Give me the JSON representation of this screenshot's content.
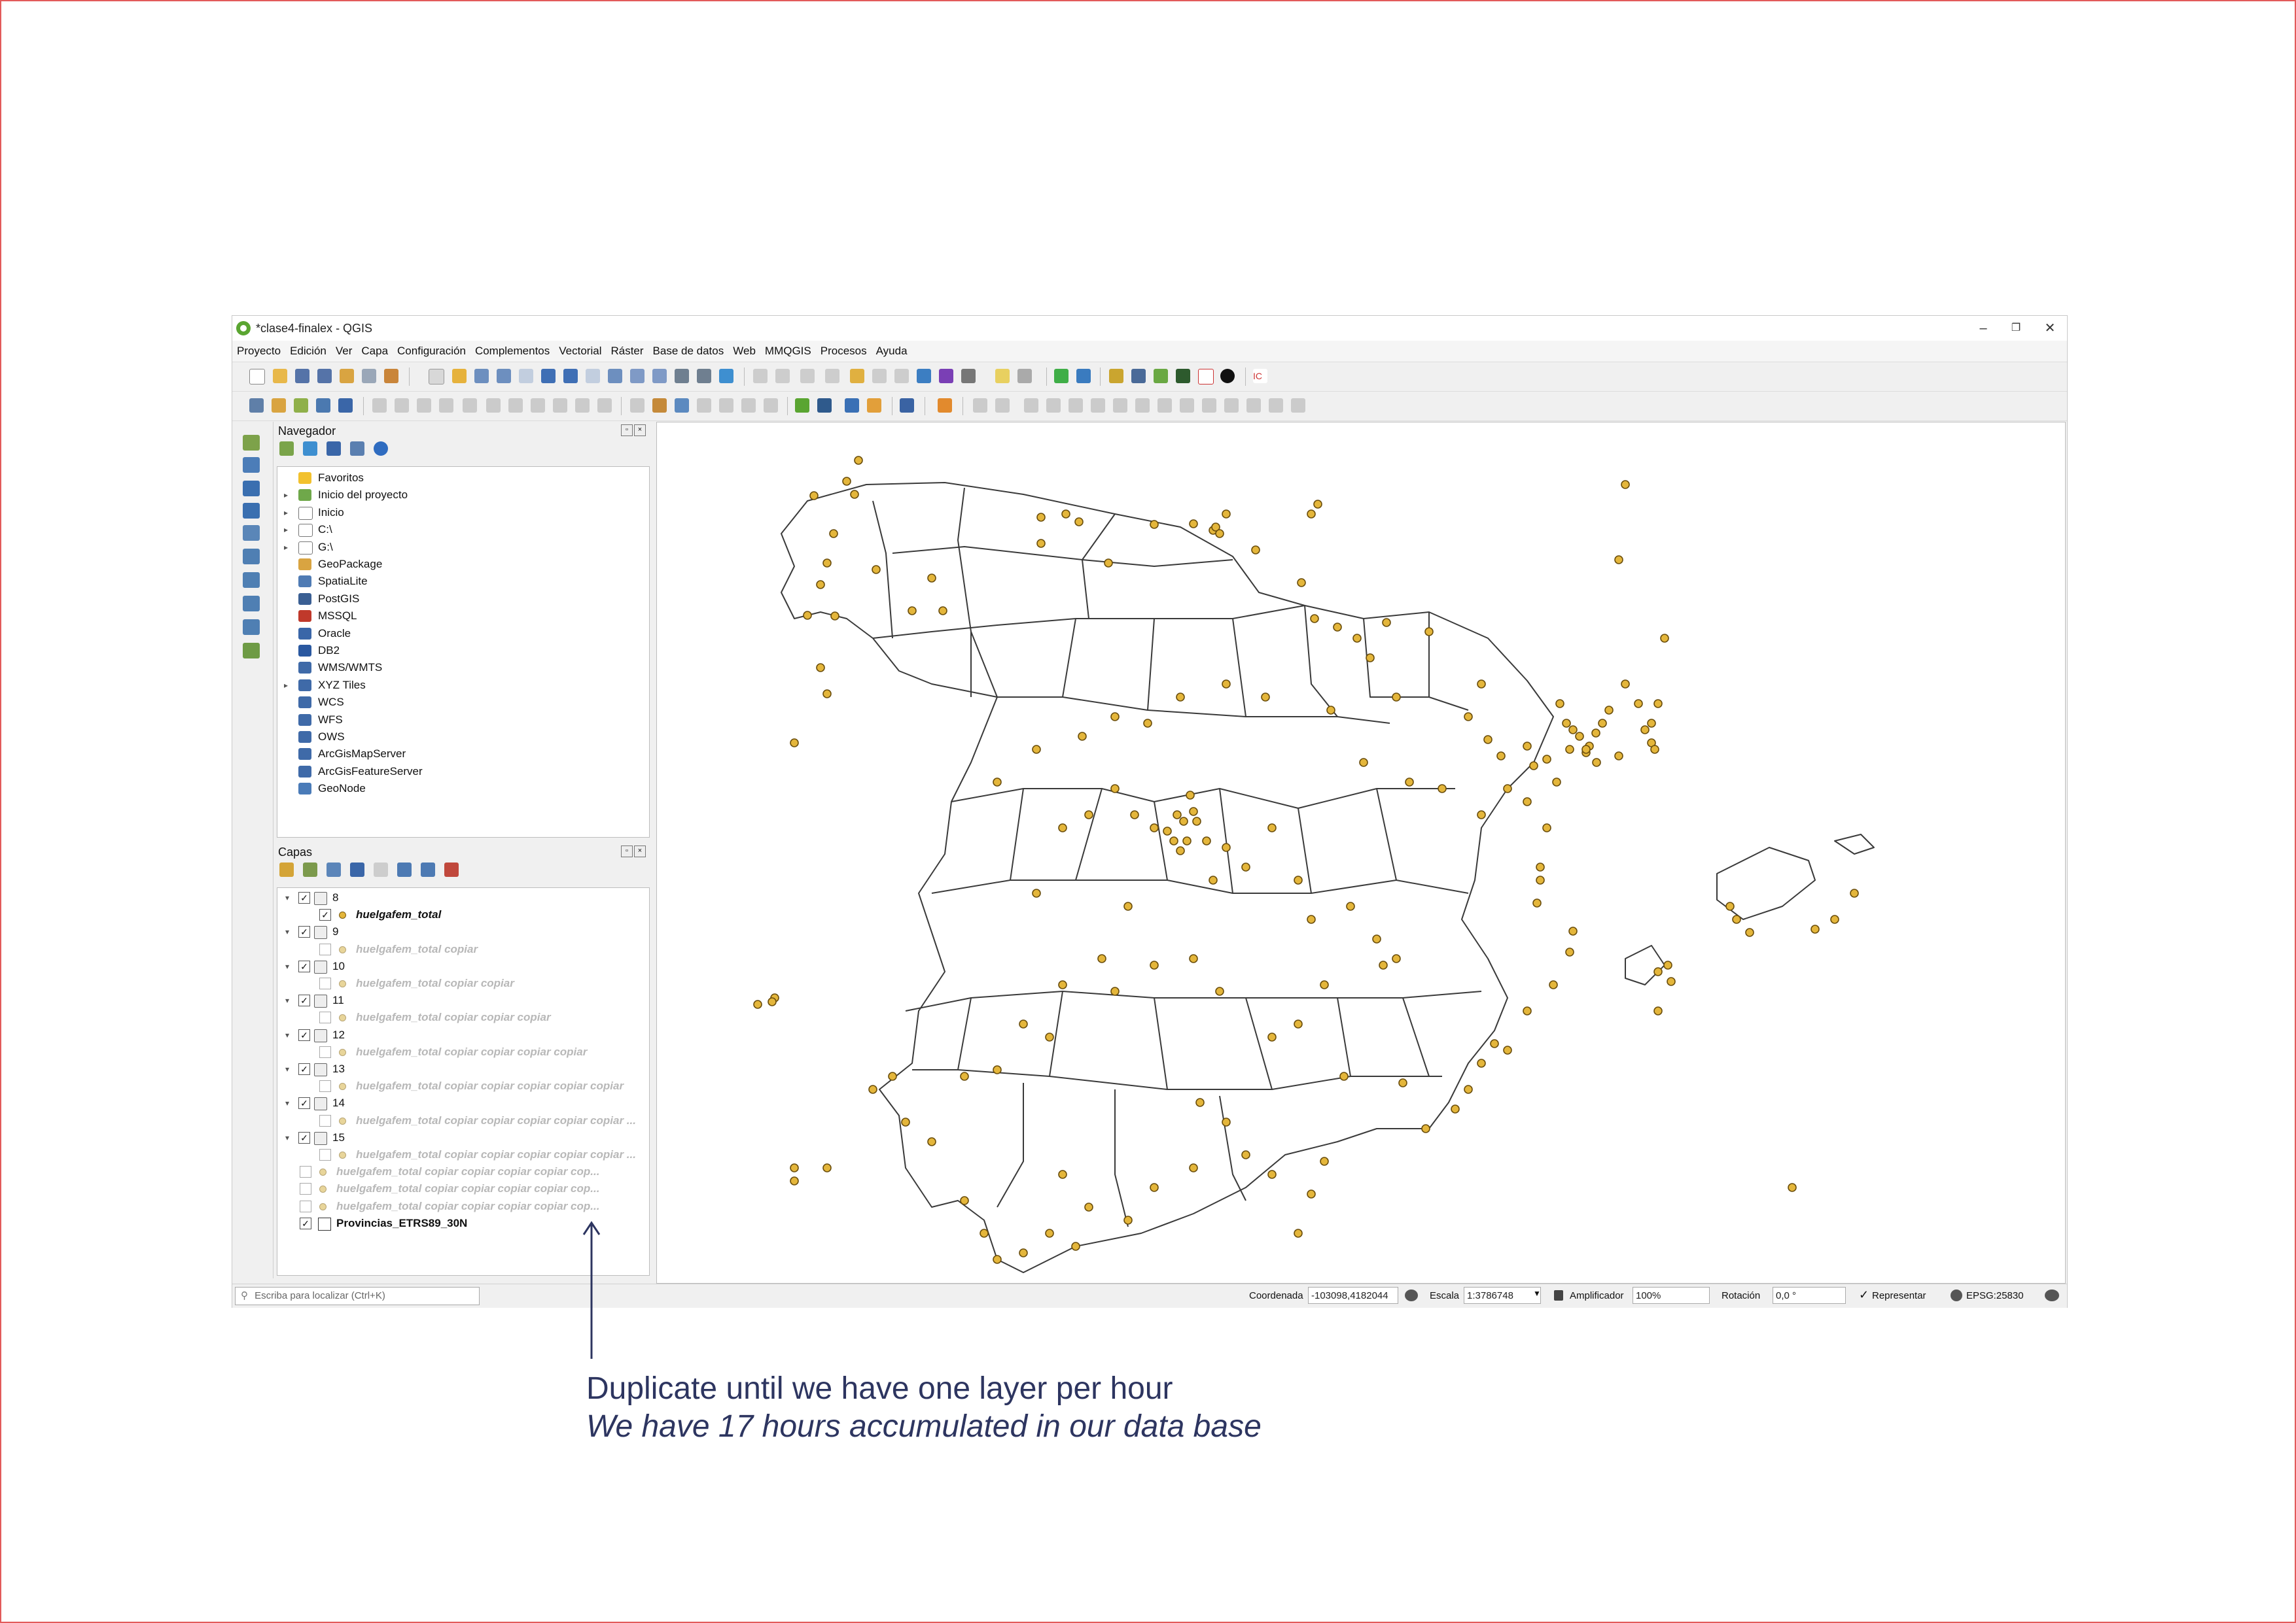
{
  "window": {
    "title": "*clase4-finalex - QGIS",
    "controls": [
      "–",
      "❐",
      "✕"
    ]
  },
  "menu": [
    "Proyecto",
    "Edición",
    "Ver",
    "Capa",
    "Configuración",
    "Complementos",
    "Vectorial",
    "Ráster",
    "Base de datos",
    "Web",
    "MMQGIS",
    "Procesos",
    "Ayuda"
  ],
  "navigator": {
    "title": "Navegador",
    "items": [
      {
        "label": "Favoritos",
        "icon": "star-icon",
        "expandable": false
      },
      {
        "label": "Inicio del proyecto",
        "icon": "project-home-icon",
        "expandable": true
      },
      {
        "label": "Inicio",
        "icon": "home-folder-icon",
        "expandable": true
      },
      {
        "label": "C:\\",
        "icon": "folder-icon",
        "expandable": true
      },
      {
        "label": "G:\\",
        "icon": "folder-icon",
        "expandable": true
      },
      {
        "label": "GeoPackage",
        "icon": "geopackage-icon",
        "expandable": false
      },
      {
        "label": "SpatiaLite",
        "icon": "spatialite-icon",
        "expandable": false
      },
      {
        "label": "PostGIS",
        "icon": "postgis-icon",
        "expandable": false
      },
      {
        "label": "MSSQL",
        "icon": "mssql-icon",
        "expandable": false
      },
      {
        "label": "Oracle",
        "icon": "oracle-icon",
        "expandable": false
      },
      {
        "label": "DB2",
        "icon": "db2-icon",
        "expandable": false
      },
      {
        "label": "WMS/WMTS",
        "icon": "globe-icon",
        "expandable": false
      },
      {
        "label": "XYZ Tiles",
        "icon": "globe-icon",
        "expandable": true
      },
      {
        "label": "WCS",
        "icon": "globe-icon",
        "expandable": false
      },
      {
        "label": "WFS",
        "icon": "globe-icon",
        "expandable": false
      },
      {
        "label": "OWS",
        "icon": "globe-icon",
        "expandable": false
      },
      {
        "label": "ArcGisMapServer",
        "icon": "arcgis-icon",
        "expandable": false
      },
      {
        "label": "ArcGisFeatureServer",
        "icon": "arcgis-icon",
        "expandable": false
      },
      {
        "label": "GeoNode",
        "icon": "geonode-icon",
        "expandable": false
      }
    ]
  },
  "layers": {
    "title": "Capas",
    "rows": [
      {
        "type": "group",
        "label": "8",
        "checked": true,
        "indent": 0
      },
      {
        "type": "point",
        "label": "huelgafem_total",
        "checked": true,
        "indent": 1,
        "active": true
      },
      {
        "type": "group",
        "label": "9",
        "checked": true,
        "indent": 0
      },
      {
        "type": "point",
        "label": "huelgafem_total copiar",
        "checked": false,
        "indent": 1,
        "active": false
      },
      {
        "type": "group",
        "label": "10",
        "checked": true,
        "indent": 0
      },
      {
        "type": "point",
        "label": "huelgafem_total copiar copiar",
        "checked": false,
        "indent": 1,
        "active": false
      },
      {
        "type": "group",
        "label": "11",
        "checked": true,
        "indent": 0
      },
      {
        "type": "point",
        "label": "huelgafem_total copiar copiar copiar",
        "checked": false,
        "indent": 1,
        "active": false
      },
      {
        "type": "group",
        "label": "12",
        "checked": true,
        "indent": 0
      },
      {
        "type": "point",
        "label": "huelgafem_total copiar copiar copiar copiar",
        "checked": false,
        "indent": 1,
        "active": false
      },
      {
        "type": "group",
        "label": "13",
        "checked": true,
        "indent": 0
      },
      {
        "type": "point",
        "label": "huelgafem_total copiar copiar copiar copiar copiar",
        "checked": false,
        "indent": 1,
        "active": false
      },
      {
        "type": "group",
        "label": "14",
        "checked": true,
        "indent": 0
      },
      {
        "type": "point",
        "label": "huelgafem_total copiar copiar copiar copiar copiar ...",
        "checked": false,
        "indent": 1,
        "active": false
      },
      {
        "type": "group",
        "label": "15",
        "checked": true,
        "indent": 0
      },
      {
        "type": "point",
        "label": "huelgafem_total copiar copiar copiar copiar copiar ...",
        "checked": false,
        "indent": 1,
        "active": false
      },
      {
        "type": "point",
        "label": "huelgafem_total copiar copiar copiar copiar cop...",
        "checked": false,
        "indent": 0,
        "active": false
      },
      {
        "type": "point",
        "label": "huelgafem_total copiar copiar copiar copiar cop...",
        "checked": false,
        "indent": 0,
        "active": false
      },
      {
        "type": "point",
        "label": "huelgafem_total copiar copiar copiar copiar cop...",
        "checked": false,
        "indent": 0,
        "active": false
      },
      {
        "type": "polygon",
        "label": "Provincias_ETRS89_30N",
        "checked": true,
        "indent": 0,
        "active": true
      }
    ]
  },
  "statusbar": {
    "search_placeholder": "Escriba para localizar (Ctrl+K)",
    "coord_label": "Coordenada",
    "coord_value": "-103098,4182044",
    "scale_label": "Escala",
    "scale_value": "1:3786748",
    "magnifier_label": "Amplificador",
    "magnifier_value": "100%",
    "rotation_label": "Rotación",
    "rotation_value": "0,0 °",
    "render_label": "Representar",
    "render_checked": "✓",
    "crs": "EPSG:25830"
  },
  "annotation": {
    "line1": "Duplicate until we have one layer per hour",
    "line2": "We have 17 hours accumulated in our data base"
  },
  "colors": {
    "point_fill": "#e4b63b",
    "point_stroke": "#6b4e0c",
    "annotation": "#2d3560",
    "frame": "#e25b5b"
  }
}
